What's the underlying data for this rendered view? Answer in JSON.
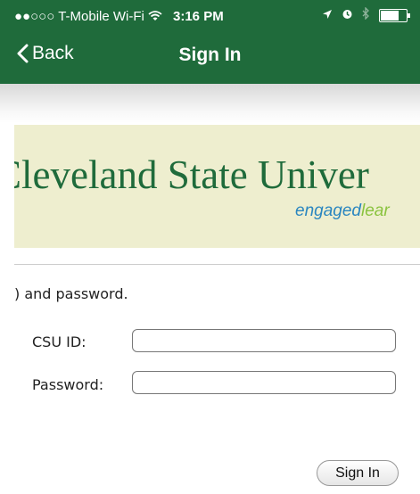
{
  "status_bar": {
    "signal": "●●○○○",
    "carrier": "T-Mobile Wi-Fi",
    "time": "3:16 PM"
  },
  "nav": {
    "back_label": "Back",
    "title": "Sign In"
  },
  "banner": {
    "title": "Cleveland State Univer",
    "tagline_part1": "engaged",
    "tagline_part2": "lear"
  },
  "form": {
    "instructions": ") and password.",
    "csu_id_label": "CSU ID:",
    "password_label": "Password:",
    "csu_id_value": "",
    "password_value": "",
    "submit_label": "Sign In"
  },
  "colors": {
    "header_green": "#1f6b3b",
    "banner_bg": "#eeeecf",
    "tagline_blue": "#2a86c0",
    "tagline_green": "#8ac33f"
  }
}
